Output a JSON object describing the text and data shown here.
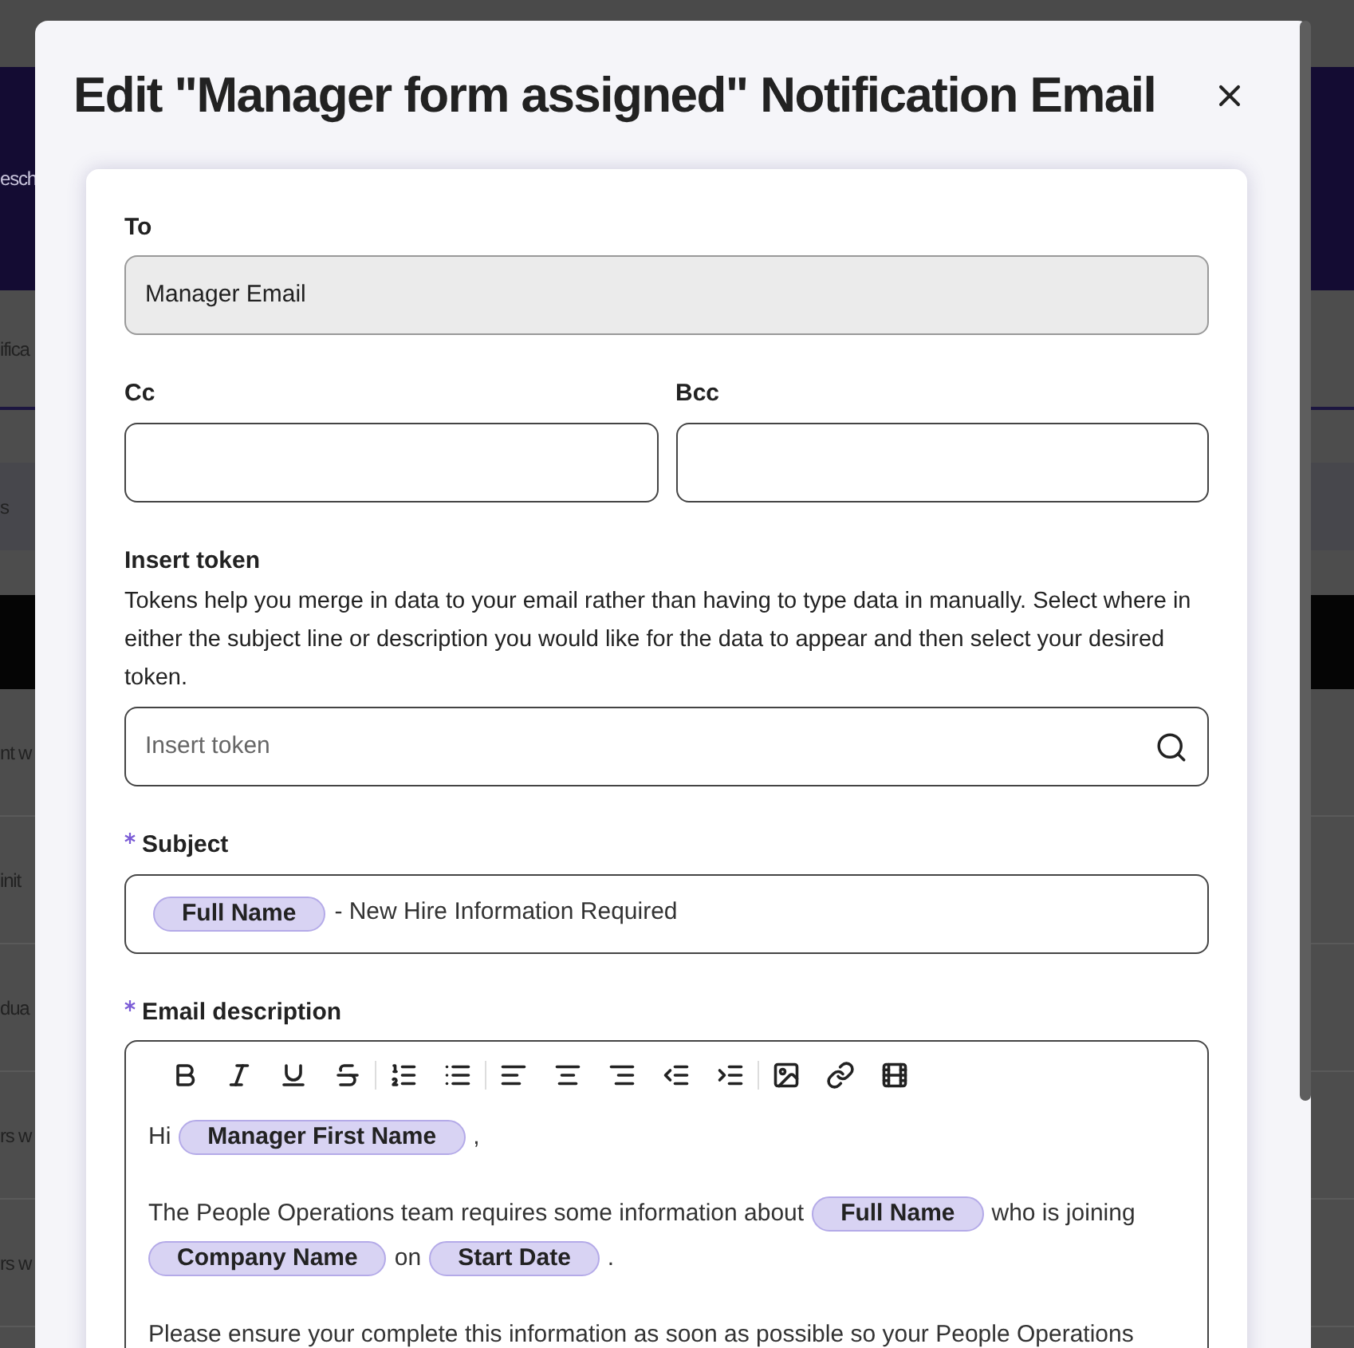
{
  "background": {
    "header_text": "esch",
    "tab_text": "ifica",
    "filter_text": "s",
    "rows": [
      "nt w",
      "init",
      "dua",
      "rs w",
      "rs w"
    ]
  },
  "modal": {
    "title": "Edit \"Manager form assigned\" Notification Email",
    "to": {
      "label": "To",
      "value": "Manager Email",
      "disabled": true
    },
    "cc": {
      "label": "Cc"
    },
    "bcc": {
      "label": "Bcc"
    },
    "insert_token": {
      "label": "Insert token",
      "help": "Tokens help you merge in data to your email rather than having to type data in manually. Select where in either the subject line or description you would like for the data to appear and then select your desired token.",
      "placeholder": "Insert token"
    },
    "subject": {
      "label": "Subject",
      "required": true,
      "segments": [
        {
          "kind": "token",
          "text": "Full Name"
        },
        {
          "kind": "text",
          "text": "- New Hire Information Required"
        }
      ]
    },
    "description": {
      "label": "Email description",
      "required": true,
      "toolbar": [
        [
          {
            "kind": "bold"
          },
          {
            "kind": "italic"
          },
          {
            "kind": "underline"
          },
          {
            "kind": "strikethrough"
          }
        ],
        [
          {
            "kind": "ordered-list"
          },
          {
            "kind": "bullet-list"
          }
        ],
        [
          {
            "kind": "align-left"
          },
          {
            "kind": "align-center"
          },
          {
            "kind": "align-right"
          },
          {
            "kind": "outdent"
          },
          {
            "kind": "indent"
          }
        ],
        [
          {
            "kind": "image"
          },
          {
            "kind": "link"
          },
          {
            "kind": "video"
          }
        ]
      ],
      "paragraphs": [
        [
          {
            "kind": "text",
            "text": "Hi"
          },
          {
            "kind": "token",
            "text": "Manager First Name"
          },
          {
            "kind": "text",
            "text": ","
          }
        ],
        [
          {
            "kind": "text",
            "text": "The People Operations team requires some information about"
          },
          {
            "kind": "token",
            "text": "Full Name"
          },
          {
            "kind": "text",
            "text": "who is joining"
          },
          {
            "kind": "token",
            "text": "Company Name"
          },
          {
            "kind": "text",
            "text": "on"
          },
          {
            "kind": "token",
            "text": "Start Date"
          },
          {
            "kind": "text",
            "text": "."
          }
        ],
        [
          {
            "kind": "text",
            "text": "Please ensure your complete this information as soon as possible so your People Operations"
          }
        ]
      ]
    }
  }
}
